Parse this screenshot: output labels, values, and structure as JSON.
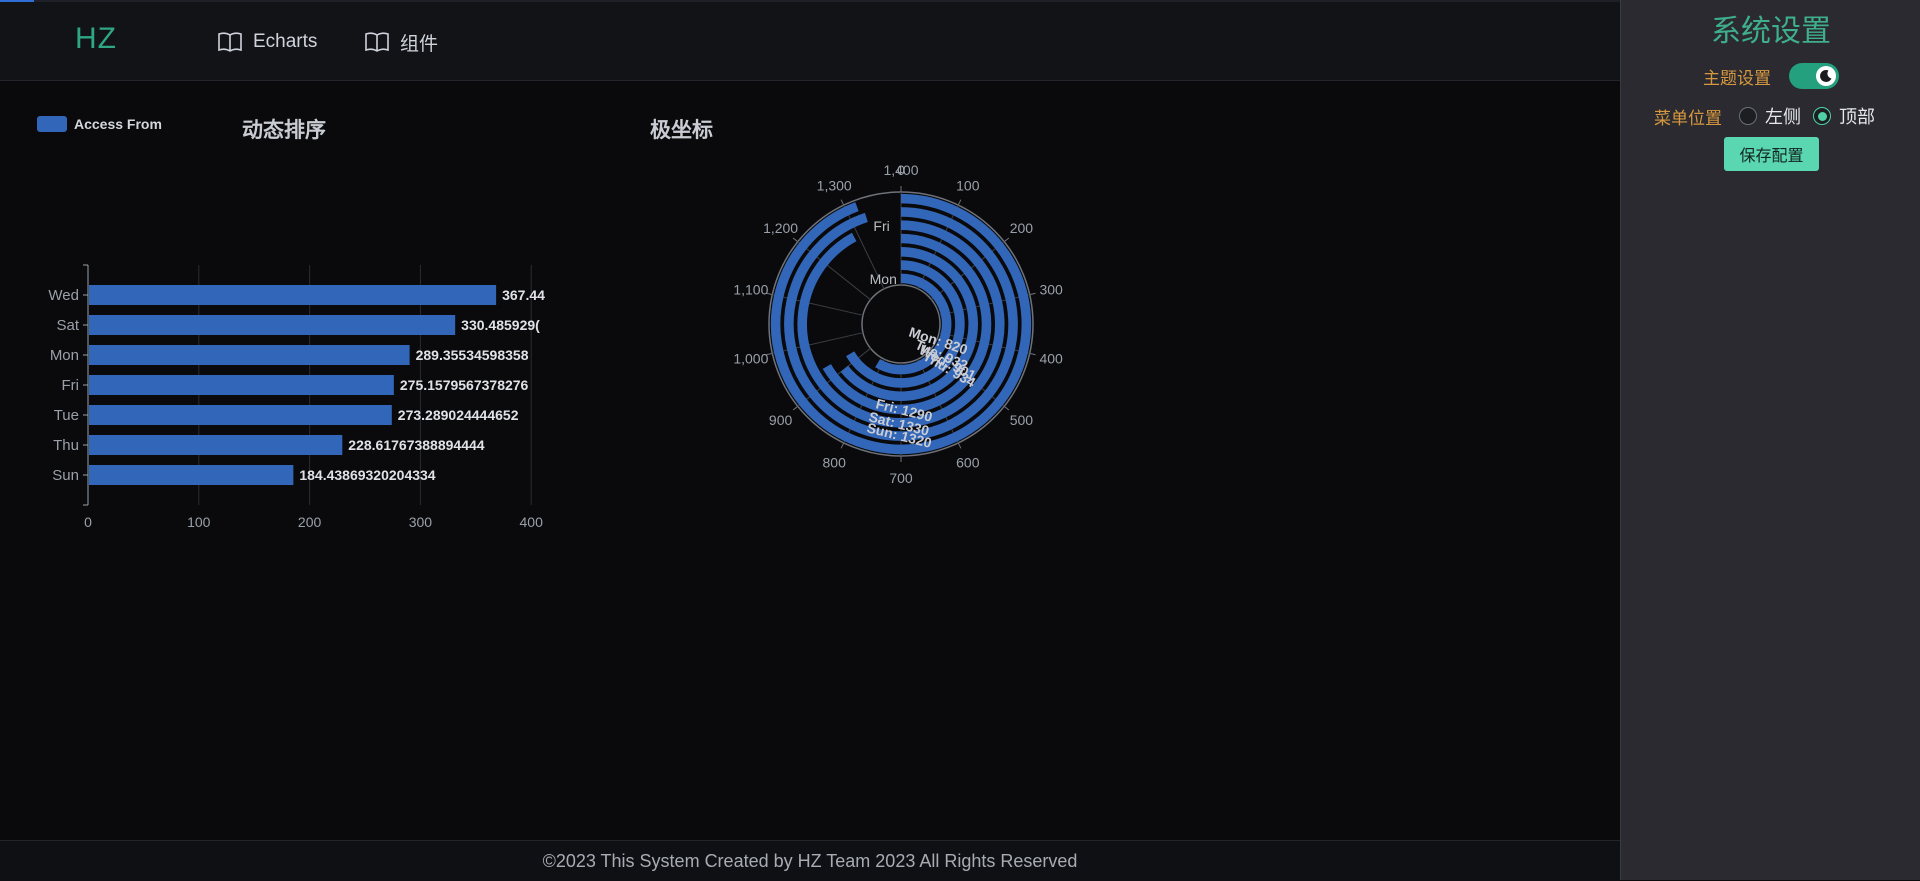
{
  "header": {
    "logo": "HZ",
    "nav": [
      {
        "label": "Echarts",
        "icon": "book-icon"
      },
      {
        "label": "组件",
        "icon": "book-icon"
      }
    ]
  },
  "settings": {
    "title": "系统设置",
    "theme_label": "主题设置",
    "theme_dark": true,
    "menu_label": "菜单位置",
    "menu_options": [
      "左侧",
      "顶部"
    ],
    "menu_selected": "顶部",
    "save_label": "保存配置"
  },
  "footer": {
    "text": "©2023 This System Created by HZ Team 2023 All Rights Reserved"
  },
  "colors": {
    "accent": "#3fae8a",
    "bar": "#3266b8",
    "panel": "#2a2a30",
    "label_orange": "#d6983f"
  },
  "chart_data": [
    {
      "type": "bar",
      "title": "动态排序",
      "orientation": "horizontal",
      "legend": {
        "entries": [
          "Access From"
        ],
        "position": "top-left"
      },
      "categories": [
        "Wed",
        "Sat",
        "Mon",
        "Fri",
        "Tue",
        "Thu",
        "Sun"
      ],
      "series": [
        {
          "name": "Access From",
          "values": [
            367.44,
            330.4859296,
            289.35534598358,
            275.1579567378276,
            273.289024444652,
            228.61767388894444,
            184.43869320204334
          ]
        }
      ],
      "value_labels": [
        "367.44",
        "330.485929(",
        "289.35534598358",
        "275.1579567378276",
        "273.289024444652",
        "228.61767388894444",
        "184.43869320204334"
      ],
      "xticks": [
        0,
        100,
        200,
        300,
        400
      ],
      "xlim": [
        0,
        400
      ],
      "grid": true
    },
    {
      "type": "bar",
      "subtype": "polar-radial",
      "title": "极坐标",
      "categories": [
        "Mon",
        "Tue",
        "Wed",
        "Thu",
        "Fri",
        "Sat",
        "Sun"
      ],
      "series": [
        {
          "values": [
            820,
            932,
            901,
            934,
            1290,
            1330,
            1320
          ]
        }
      ],
      "value_labels": [
        "Mon: 820",
        "Tue: 932",
        "Wed: 901",
        "Thu: 934",
        "Fri: 1290",
        "Sat: 1330",
        "Sun: 1320"
      ],
      "angle_ticks": [
        0,
        100,
        200,
        300,
        400,
        500,
        600,
        700,
        800,
        900,
        "1,000",
        "1,100",
        "1,200",
        "1,300",
        "1,400"
      ],
      "angle_max": 1400,
      "radial_labels_shown": [
        "Mon",
        "Fri"
      ]
    }
  ]
}
